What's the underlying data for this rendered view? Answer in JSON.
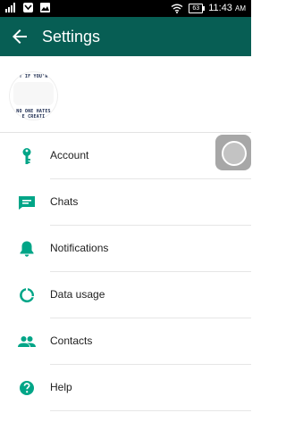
{
  "status_bar": {
    "battery": "63",
    "time": "11:43",
    "ampm": "AM"
  },
  "header": {
    "title": "Settings"
  },
  "profile": {
    "avatar_text_top": "T IF YOU'R",
    "avatar_text_line2": "NO ONE HATES",
    "avatar_text_line3": "E CREATI"
  },
  "menu": [
    {
      "label": "Account",
      "icon": "key-icon"
    },
    {
      "label": "Chats",
      "icon": "chat-icon"
    },
    {
      "label": "Notifications",
      "icon": "bell-icon"
    },
    {
      "label": "Data usage",
      "icon": "data-usage-icon"
    },
    {
      "label": "Contacts",
      "icon": "contacts-icon"
    },
    {
      "label": "Help",
      "icon": "help-icon"
    }
  ],
  "colors": {
    "app_bar": "#075e54",
    "icon_accent": "#00a587"
  }
}
